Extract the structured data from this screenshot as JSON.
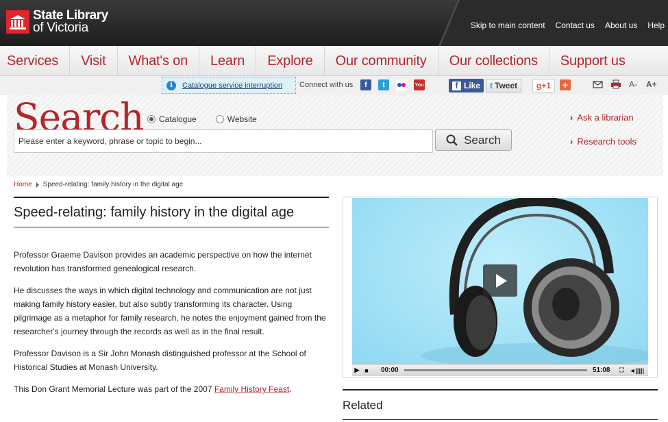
{
  "header": {
    "logo_line1": "State Library",
    "logo_line2": "of Victoria",
    "top_links": [
      "Skip to main content",
      "Contact us",
      "About us",
      "Help"
    ]
  },
  "nav": {
    "items": [
      "Services",
      "Visit",
      "What's on",
      "Learn",
      "Explore",
      "Our community",
      "Our collections",
      "Support us"
    ]
  },
  "utility": {
    "notice": "Catalogue service interruption",
    "connect_label": "Connect with us",
    "like_label": "Like",
    "tweet_label": "Tweet",
    "gplus_label": "+1",
    "font_smaller": "A-",
    "font_larger": "A+"
  },
  "search": {
    "title": "Search",
    "option_catalogue": "Catalogue",
    "option_website": "Website",
    "selected": "Catalogue",
    "placeholder": "Please enter a keyword, phrase or topic to begin...",
    "button_label": "Search",
    "side_links": [
      "Ask a librarian",
      "Research tools"
    ]
  },
  "breadcrumb": {
    "home": "Home",
    "current": "Speed-relating: family history in the digital age"
  },
  "article": {
    "title": "Speed-relating: family history in the digital age",
    "p1": "Professor Graeme Davison provides an academic perspective on how the internet revolution has transformed genealogical research.",
    "p2": "He discusses the ways in which digital technology and communication are not just making family history easier, but also subtly transforming its character. Using pilgrimage as a metaphor for family research, he notes the enjoyment gained from the researcher's journey through the records as well as in the final result.",
    "p3": "Professor Davison is a Sir John Monash distinguished professor at the School of Historical Studies at Monash University.",
    "p4_prefix": "This Don Grant Memorial Lecture was part of the 2007 ",
    "p4_link": "Family History Feast",
    "p4_suffix": "."
  },
  "video": {
    "current_time": "00:00",
    "duration": "51:08",
    "progress": 0
  },
  "related": {
    "heading": "Related"
  },
  "colors": {
    "brand_red": "#b2262b",
    "header_bg": "#2b2b2b",
    "facebook": "#3b5998",
    "twitter": "#2a9fd6"
  }
}
